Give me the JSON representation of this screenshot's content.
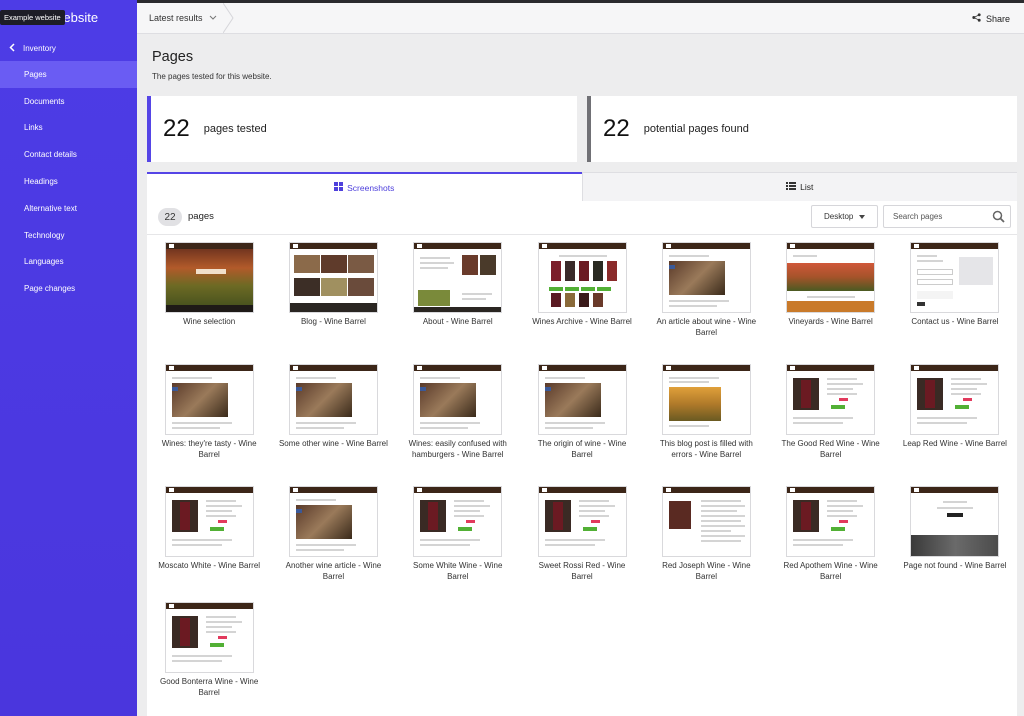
{
  "site": {
    "name": "Example website",
    "tooltip": "Example website",
    "name_visible": "website"
  },
  "sidebar": {
    "back_label": "Inventory",
    "items": [
      {
        "label": "Pages",
        "active": true
      },
      {
        "label": "Documents"
      },
      {
        "label": "Links"
      },
      {
        "label": "Contact details"
      },
      {
        "label": "Headings"
      },
      {
        "label": "Alternative text"
      },
      {
        "label": "Technology"
      },
      {
        "label": "Languages"
      },
      {
        "label": "Page changes"
      }
    ]
  },
  "header": {
    "breadcrumb": "Latest results",
    "share_label": "Share"
  },
  "main": {
    "title": "Pages",
    "subtitle": "The pages tested for this website.",
    "stats": [
      {
        "value": "22",
        "label": "pages tested"
      },
      {
        "value": "22",
        "label": "potential pages found"
      }
    ],
    "tabs": [
      {
        "label": "Screenshots",
        "active": true
      },
      {
        "label": "List"
      }
    ],
    "toolbar": {
      "count": "22",
      "count_label": "pages",
      "device": "Desktop",
      "search_placeholder": "Search pages"
    },
    "pages": [
      {
        "title": "Wine selection",
        "kind": "hero"
      },
      {
        "title": "Blog - Wine Barrel",
        "kind": "blog"
      },
      {
        "title": "About - Wine Barrel",
        "kind": "about"
      },
      {
        "title": "Wines Archive - Wine Barrel",
        "kind": "archive"
      },
      {
        "title": "An article about wine - Wine Barrel",
        "kind": "article"
      },
      {
        "title": "Vineyards - Wine Barrel",
        "kind": "vineyard"
      },
      {
        "title": "Contact us - Wine Barrel",
        "kind": "contact"
      },
      {
        "title": "Wines: they're tasty - Wine Barrel",
        "kind": "article"
      },
      {
        "title": "Some other wine - Wine Barrel",
        "kind": "article"
      },
      {
        "title": "Wines: easily confused with hamburgers - Wine Barrel",
        "kind": "article"
      },
      {
        "title": "The origin of wine - Wine Barrel",
        "kind": "article"
      },
      {
        "title": "This blog post is filled with errors - Wine Barrel",
        "kind": "vineyard2"
      },
      {
        "title": "The Good Red Wine - Wine Barrel",
        "kind": "product"
      },
      {
        "title": "Leap Red Wine - Wine Barrel",
        "kind": "product"
      },
      {
        "title": "Moscato White - Wine Barrel",
        "kind": "product"
      },
      {
        "title": "Another wine article - Wine Barrel",
        "kind": "article"
      },
      {
        "title": "Some White Wine - Wine Barrel",
        "kind": "product"
      },
      {
        "title": "Sweet Rossi Red - Wine Barrel",
        "kind": "product"
      },
      {
        "title": "Red Joseph Wine - Wine Barrel",
        "kind": "text"
      },
      {
        "title": "Red Apothem Wine - Wine Barrel",
        "kind": "product"
      },
      {
        "title": "Page not found - Wine Barrel",
        "kind": "notfound"
      },
      {
        "title": "Good Bonterra Wine - Wine Barrel",
        "kind": "product"
      }
    ]
  },
  "colors": {
    "accent": "#5545e6",
    "sidebar": "#4d3ce6",
    "active_item": "#6a5cf3"
  }
}
